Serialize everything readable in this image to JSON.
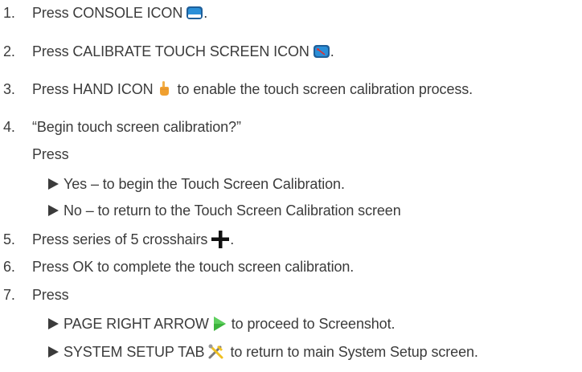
{
  "steps": [
    {
      "num": "1.",
      "pre": "Press CONSOLE ICON",
      "post": ".",
      "icon": "console-icon"
    },
    {
      "num": "2.",
      "pre": "Press CALIBRATE TOUCH SCREEN ICON",
      "post": ".",
      "icon": "calibrate-touch-screen-icon"
    },
    {
      "num": "3.",
      "pre": "Press HAND ICON",
      "post": "to enable the touch screen calibration process.",
      "icon": "hand-icon"
    },
    {
      "num": "4.",
      "text": "“Begin touch screen calibration?”"
    },
    {
      "num": "5.",
      "pre": "Press series of 5 crosshairs",
      "post": ".",
      "icon": "crosshair-icon"
    },
    {
      "num": "6.",
      "text": "Press OK to complete the touch screen calibration."
    },
    {
      "num": "7.",
      "text": "Press"
    }
  ],
  "step4_sub": {
    "press": "Press",
    "options": [
      "Yes – to begin the Touch Screen Calibration.",
      "No – to return to the Touch Screen Calibration screen"
    ]
  },
  "step7_sub": [
    {
      "pre": "PAGE RIGHT ARROW",
      "post": "to proceed to Screenshot.",
      "icon": "page-right-arrow-icon"
    },
    {
      "pre": "SYSTEM SETUP TAB",
      "post": "to return to main System Setup screen.",
      "icon": "system-setup-tab-icon"
    }
  ],
  "colors": {
    "text": "#3b3b3b",
    "console_blue": "#2a8fd8",
    "hand_orange": "#f0a030",
    "arrow_green": "#3cb43c"
  }
}
